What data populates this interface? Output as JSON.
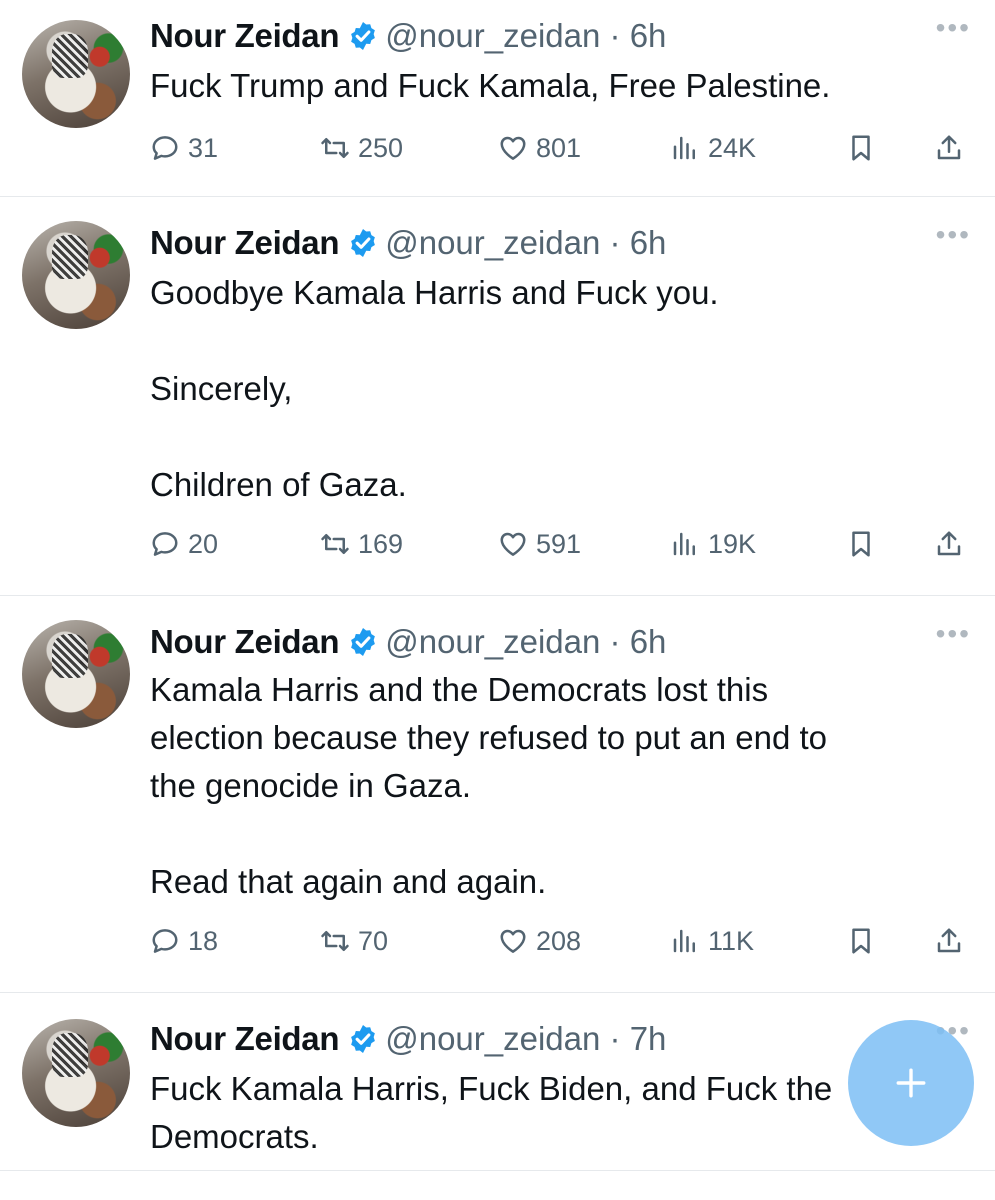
{
  "colors": {
    "secondary_text": "#536471",
    "verified_blue": "#1d9bf0",
    "fab": "#7dbef5"
  },
  "tweets": [
    {
      "name": "Nour Zeidan",
      "handle": "@nour_zeidan · 6h",
      "text": "Fuck Trump and Fuck Kamala, Free Palestine.",
      "replies": "31",
      "reposts": "250",
      "likes": "801",
      "views": "24K"
    },
    {
      "name": "Nour Zeidan",
      "handle": "@nour_zeidan · 6h",
      "text": "Goodbye Kamala Harris and Fuck you.\n\nSincerely,\n\nChildren of Gaza.",
      "replies": "20",
      "reposts": "169",
      "likes": "591",
      "views": "19K"
    },
    {
      "name": "Nour Zeidan",
      "handle": "@nour_zeidan · 6h",
      "text": "Kamala Harris and the Democrats lost this\nelection because they refused to put an end to\nthe genocide in Gaza.\n\nRead that again and again.",
      "replies": "18",
      "reposts": "70",
      "likes": "208",
      "views": "11K"
    },
    {
      "name": "Nour Zeidan",
      "handle": "@nour_zeidan · 7h",
      "text": "Fuck Kamala Harris, Fuck Biden, and Fuck the\nDemocrats."
    }
  ],
  "icons": {
    "more": "more-horizontal-icon",
    "reply": "reply-icon",
    "repost": "repost-icon",
    "like": "heart-icon",
    "views": "analytics-icon",
    "bookmark": "bookmark-icon",
    "share": "share-icon",
    "compose": "compose-plus-icon"
  }
}
